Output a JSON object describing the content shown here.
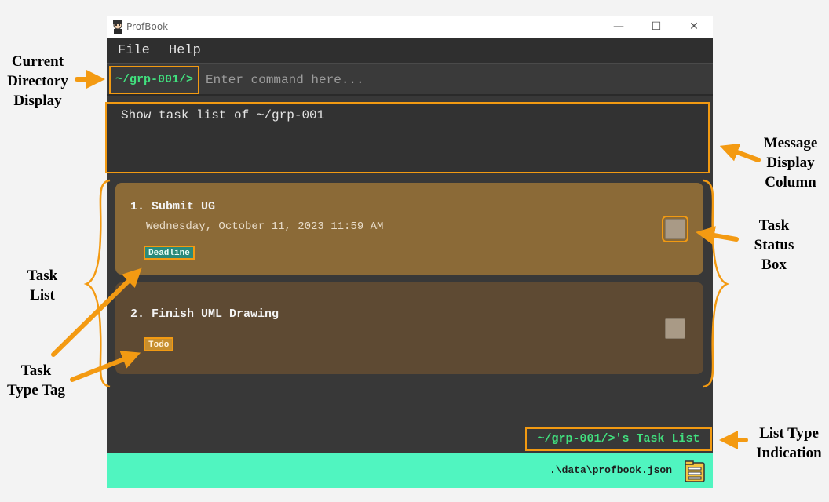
{
  "window": {
    "title": "ProfBook",
    "minimize": "—",
    "maximize": "☐",
    "close": "✕"
  },
  "menu": {
    "items": [
      "File",
      "Help"
    ]
  },
  "command": {
    "current_directory": "~/grp-001/>",
    "placeholder": "Enter command here..."
  },
  "message": {
    "text": "Show task list of ~/grp-001"
  },
  "tasks": [
    {
      "title": "1.  Submit UG",
      "date": "Wednesday, October 11, 2023 11:59 AM",
      "tag": "Deadline"
    },
    {
      "title": "2.  Finish UML Drawing",
      "tag": "Todo"
    }
  ],
  "list_type": "~/grp-001/>'s Task List",
  "status_bar": {
    "file_path": ".\\data\\profbook.json"
  },
  "annotations": {
    "current_directory": [
      "Current",
      "Directory",
      "Display"
    ],
    "message_display": [
      "Message",
      "Display",
      "Column"
    ],
    "task_list": [
      "Task",
      "List"
    ],
    "task_status": [
      "Task",
      "Status",
      "Box"
    ],
    "task_type": [
      "Task",
      "Type Tag"
    ],
    "list_type": [
      "List Type",
      "Indication"
    ]
  },
  "colors": {
    "highlight": "#f29a12",
    "accent_green": "#41e07e",
    "status_bar": "#50f5c0",
    "deadline_card": "#8b6a37",
    "todo_card": "#5e4a33"
  }
}
